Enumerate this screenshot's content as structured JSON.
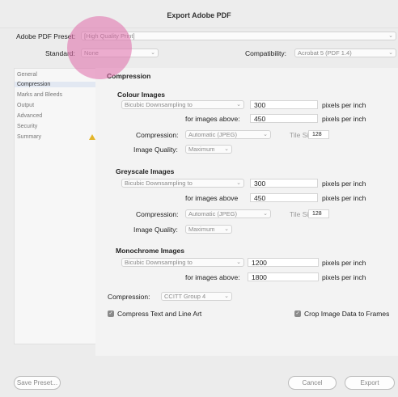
{
  "window": {
    "title": "Export Adobe PDF"
  },
  "header": {
    "preset_label": "Adobe PDF Preset:",
    "preset_value": "[High Quality Print]",
    "standard_label": "Standard:",
    "standard_value": "None",
    "compat_label": "Compatibility:",
    "compat_value": "Acrobat 5 (PDF 1.4)"
  },
  "sidebar": {
    "items": [
      {
        "label": "General"
      },
      {
        "label": "Compression"
      },
      {
        "label": "Marks and Bleeds"
      },
      {
        "label": "Output"
      },
      {
        "label": "Advanced"
      },
      {
        "label": "Security"
      },
      {
        "label": "Summary"
      }
    ],
    "selected": "Compression"
  },
  "panel": {
    "title": "Compression",
    "colour": {
      "heading": "Colour Images",
      "sampling": "Bicubic Downsampling to",
      "ppi_value": "300",
      "ppi_unit": "pixels per inch",
      "above_label": "for images above:",
      "above_value": "450",
      "above_unit": "pixels per inch",
      "compression_label": "Compression:",
      "compression_value": "Automatic (JPEG)",
      "tile_label": "Tile Size:",
      "tile_value": "128",
      "quality_label": "Image Quality:",
      "quality_value": "Maximum"
    },
    "greyscale": {
      "heading": "Greyscale Images",
      "sampling": "Bicubic Downsampling to",
      "ppi_value": "300",
      "ppi_unit": "pixels per inch",
      "above_label": "for images above",
      "above_value": "450",
      "above_unit": "pixels per inch",
      "compression_label": "Compression:",
      "compression_value": "Automatic (JPEG)",
      "tile_label": "Tile Size:",
      "tile_value": "128",
      "quality_label": "Image Quality:",
      "quality_value": "Maximum"
    },
    "mono": {
      "heading": "Monochrome Images",
      "sampling": "Bicubic Downsampling to",
      "ppi_value": "1200",
      "ppi_unit": "pixels per inch",
      "above_label": "for images above:",
      "above_value": "1800",
      "above_unit": "pixels per inch",
      "compression_label": "Compression:",
      "compression_value": "CCITT Group 4"
    },
    "compress_text": "Compress Text and Line Art",
    "crop_image": "Crop Image Data to Frames"
  },
  "footer": {
    "save_preset": "Save Preset...",
    "cancel": "Cancel",
    "export": "Export"
  },
  "colors": {
    "highlight_circle": "#e06caa",
    "selection": "#e2e8f2",
    "warning": "#e3b52a"
  }
}
